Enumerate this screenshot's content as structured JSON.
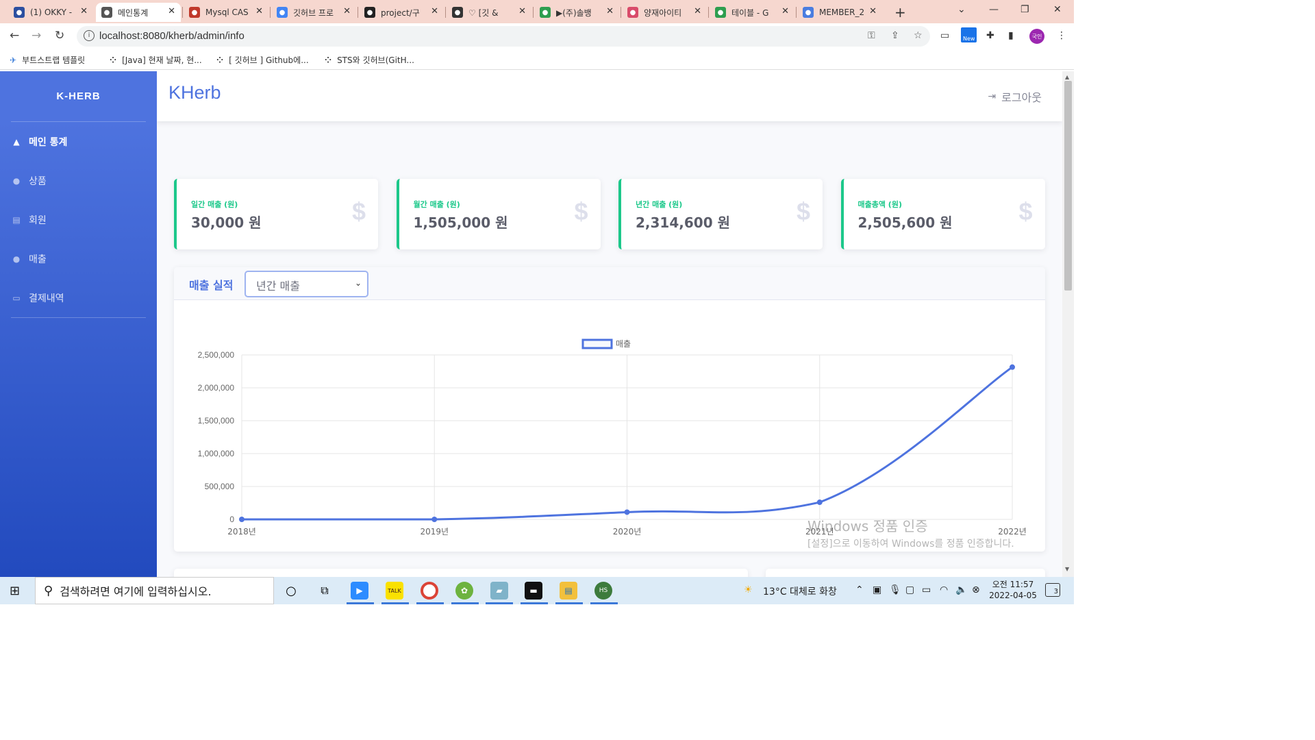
{
  "browser": {
    "tabs": [
      {
        "icon": "okky-icon",
        "title": "(1) OKKY -",
        "color": "#2c4fa0"
      },
      {
        "icon": "globe-icon",
        "title": "메인통계",
        "color": "#555555"
      },
      {
        "icon": "mysql-icon",
        "title": "Mysql CAS",
        "color": "#c0392b"
      },
      {
        "icon": "google-icon",
        "title": "깃허브 프로",
        "color": "#4285f4"
      },
      {
        "icon": "github-icon",
        "title": "project/구",
        "color": "#222222"
      },
      {
        "icon": "velog-icon",
        "title": "♡ [깃 & ",
        "color": "#333333"
      },
      {
        "icon": "job-icon",
        "title": "▶(주)솔뱅",
        "color": "#2e9e4f"
      },
      {
        "icon": "brand-icon",
        "title": "양재아이티",
        "color": "#d94b6a"
      },
      {
        "icon": "drive-icon",
        "title": "테이블 - G",
        "color": "#2e9e4f"
      },
      {
        "icon": "docs-icon",
        "title": "MEMBER_2",
        "color": "#4a7de0"
      }
    ],
    "url": "localhost:8080/kherb/admin/info",
    "ext_badge": "New",
    "profile": "국인",
    "bookmarks": [
      {
        "icon": "bootstrap-icon",
        "label": "부트스트랩 템플릿"
      },
      {
        "icon": "velog-icon",
        "label": "[Java] 현재 날짜, 현..."
      },
      {
        "icon": "velog-icon",
        "label": "[ 깃허브 ] Github에..."
      },
      {
        "icon": "velog-icon",
        "label": "STS와 깃허브(GitH..."
      }
    ]
  },
  "sidebar": {
    "brand": "K-HERB",
    "items": [
      {
        "icon": "chart-area-icon",
        "label": "메인 통계",
        "active": true
      },
      {
        "icon": "product-icon",
        "label": "상품",
        "active": false
      },
      {
        "icon": "member-card-icon",
        "label": "회원",
        "active": false
      },
      {
        "icon": "user-icon",
        "label": "매출",
        "active": false
      },
      {
        "icon": "credit-card-icon",
        "label": "결제내역",
        "active": false
      }
    ]
  },
  "topbar": {
    "title": "KHerb",
    "logout": "로그아웃"
  },
  "cards": [
    {
      "label": "일간 매출 (원)",
      "value": "30,000 원"
    },
    {
      "label": "월간 매출 (원)",
      "value": "1,505,000 원"
    },
    {
      "label": "년간 매출 (원)",
      "value": "2,314,600 원"
    },
    {
      "label": "매출총액 (원)",
      "value": "2,505,600 원"
    }
  ],
  "card_icon": "$",
  "chart_section": {
    "heading": "매출 실적",
    "select_value": "년간 매출"
  },
  "chart_data": {
    "type": "line",
    "categories": [
      "2018년",
      "2019년",
      "2020년",
      "2021년",
      "2022년"
    ],
    "series": [
      {
        "name": "매출",
        "values": [
          0,
          0,
          110000,
          260000,
          2314600
        ],
        "color": "#4e73df"
      }
    ],
    "ylim": [
      0,
      2500000
    ],
    "yticks": [
      "0",
      "500,000",
      "1,000,000",
      "1,500,000",
      "2,000,000",
      "2,500,000"
    ],
    "grid": true,
    "legend": "top-center"
  },
  "watermark": {
    "line1": "Windows 정품 인증",
    "line2": "[설정]으로 이동하여 Windows를 정품 인증합니다."
  },
  "taskbar": {
    "search_placeholder": "검색하려면 여기에 입력하십시오.",
    "weather": "13°C  대체로 화창",
    "time": "오전 11:57",
    "date": "2022-04-05",
    "notifications": "3"
  }
}
